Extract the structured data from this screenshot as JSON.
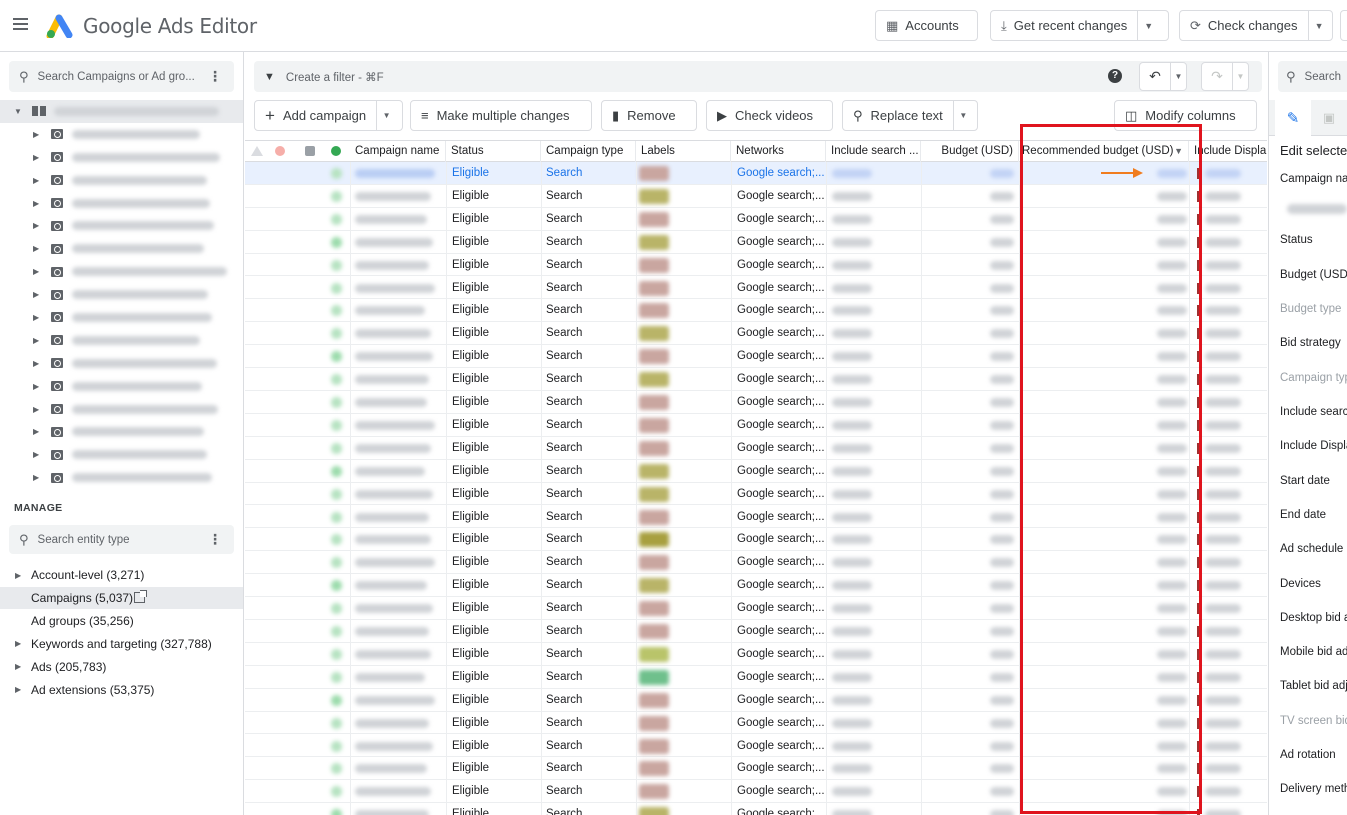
{
  "app": {
    "title": "Google Ads Editor"
  },
  "toolbar": {
    "accounts": "Accounts",
    "get_recent_changes": "Get recent changes",
    "check_changes": "Check changes"
  },
  "left": {
    "search_placeholder": "Search Campaigns or Ad gro...",
    "manage_label": "MANAGE",
    "entity_search_placeholder": "Search entity type",
    "entities": [
      {
        "label": "Account-level (3,271)",
        "expandable": true,
        "selected": false
      },
      {
        "label": "Campaigns (5,037)",
        "expandable": false,
        "selected": true
      },
      {
        "label": "Ad groups (35,256)",
        "expandable": false,
        "selected": false
      },
      {
        "label": "Keywords and targeting (327,788)",
        "expandable": true,
        "selected": false
      },
      {
        "label": "Ads (205,783)",
        "expandable": true,
        "selected": false
      },
      {
        "label": "Ad extensions (53,375)",
        "expandable": true,
        "selected": false
      }
    ]
  },
  "main": {
    "filter_placeholder": "Create a filter - ⌘F",
    "actions": {
      "add_campaign": "Add campaign",
      "make_multiple_changes": "Make multiple changes",
      "remove": "Remove",
      "check_videos": "Check videos",
      "replace_text": "Replace text",
      "modify_columns": "Modify columns"
    },
    "columns": {
      "campaign_name": "Campaign name",
      "status": "Status",
      "campaign_type": "Campaign type",
      "labels": "Labels",
      "networks": "Networks",
      "include_search": "Include search ...",
      "budget": "Budget (USD)",
      "recommended_budget": "Recommended budget (USD)",
      "include_display": "Include Displa"
    },
    "row_status": "Eligible",
    "row_type": "Search",
    "row_networks": "Google search;...",
    "label_colors": [
      "#c9a6a0",
      "#b9b468",
      "#c9a6a0",
      "#b9b468",
      "#c9a6a0",
      "#c9a6a0",
      "#c9a6a0",
      "#b9b468",
      "#c9a6a0",
      "#b9b468",
      "#c9a6a0",
      "#c9a6a0",
      "#c9a6a0",
      "#b9b468",
      "#b9b468",
      "#c9a6a0",
      "#a8a040",
      "#c9a6a0",
      "#b9b468",
      "#c9a6a0",
      "#c9a6a0",
      "#b9c46a",
      "#6fc08c",
      "#c9a6a0",
      "#c9a6a0",
      "#c9a6a0",
      "#c9a6a0",
      "#c9a6a0",
      "#b9b468"
    ]
  },
  "right": {
    "search_placeholder": "Search",
    "title": "Edit selecte",
    "fields": [
      {
        "label": "Campaign nar",
        "dim": false
      },
      {
        "label": "Status",
        "dim": false
      },
      {
        "label": "Budget (USD)",
        "dim": false
      },
      {
        "label": "Budget type",
        "dim": true
      },
      {
        "label": "Bid strategy",
        "dim": false
      },
      {
        "label": "Campaign typ",
        "dim": true
      },
      {
        "label": "Include searc",
        "dim": false
      },
      {
        "label": "Include Displa",
        "dim": false
      },
      {
        "label": "Start date",
        "dim": false
      },
      {
        "label": "End date",
        "dim": false
      },
      {
        "label": "Ad schedule",
        "dim": false
      },
      {
        "label": "Devices",
        "dim": false
      },
      {
        "label": "Desktop bid a",
        "dim": false
      },
      {
        "label": "Mobile bid ad",
        "dim": false
      },
      {
        "label": "Tablet bid adj",
        "dim": false
      },
      {
        "label": "TV screen bid",
        "dim": true
      },
      {
        "label": "Ad rotation",
        "dim": false
      },
      {
        "label": "Delivery meth",
        "dim": false
      }
    ]
  },
  "colors": {
    "highlight": "#e0141e",
    "annotation_arrow": "#f07c1e",
    "link_blue": "#1a73e8",
    "status_green": "#34a853"
  }
}
